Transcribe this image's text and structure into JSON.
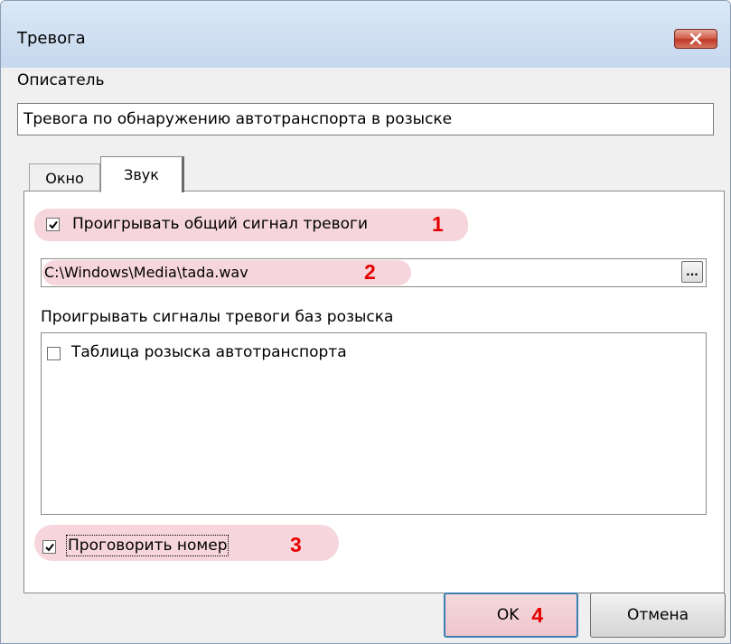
{
  "window": {
    "title": "Тревога"
  },
  "description": {
    "label": "Описатель",
    "value": "Тревога по обнаружению автотранспорта в розыске"
  },
  "tabs": [
    {
      "label": "Окно",
      "active": false
    },
    {
      "label": "Звук",
      "active": true
    }
  ],
  "sound": {
    "play_common": {
      "label": "Проигрывать общий сигнал тревоги",
      "checked": true,
      "marker": "1"
    },
    "file_path": {
      "value": "C:\\Windows\\Media\\tada.wav",
      "marker": "2",
      "browse_label": "..."
    },
    "bases_label": "Проигрывать сигналы тревоги баз розыска",
    "bases": [
      {
        "label": "Таблица розыска автотранспорта",
        "checked": false
      }
    ],
    "speak_number": {
      "label": "Проговорить номер",
      "checked": true,
      "marker": "3"
    }
  },
  "buttons": {
    "ok": {
      "label": "OK",
      "marker": "4"
    },
    "cancel": {
      "label": "Отмена"
    }
  },
  "colors": {
    "highlight": "#f6d6dc",
    "marker": "#e60000",
    "close_button": "#c0392b"
  }
}
